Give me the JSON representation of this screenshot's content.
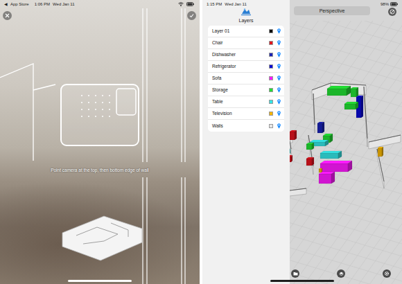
{
  "capture": {
    "status_bar": {
      "back_glyph": "◀",
      "back_app": "App Store",
      "time": "1:06 PM",
      "date": "Wed Jan 11"
    },
    "instruction": "Point camera at the top, then bottom edge of wall"
  },
  "editor": {
    "status_bar": {
      "time": "1:15 PM",
      "date": "Wed Jan 11",
      "battery": "98%"
    },
    "view_button": "Perspective",
    "layers_title": "Layers",
    "layers": [
      {
        "name": "Layer 01",
        "color": "#000000",
        "visible": true
      },
      {
        "name": "Chair",
        "color": "#e0141e",
        "visible": true
      },
      {
        "name": "Dishwasher",
        "color": "#1a22b4",
        "visible": true
      },
      {
        "name": "Refrigerator",
        "color": "#0a0ad2",
        "visible": true
      },
      {
        "name": "Sofa",
        "color": "#ff1aff",
        "visible": true
      },
      {
        "name": "Storage",
        "color": "#22dd33",
        "visible": true
      },
      {
        "name": "Table",
        "color": "#33e4e4",
        "visible": true
      },
      {
        "name": "Television",
        "color": "#f5b400",
        "visible": true
      },
      {
        "name": "Walls",
        "color": "#e6e6e6",
        "visible": true
      }
    ]
  }
}
